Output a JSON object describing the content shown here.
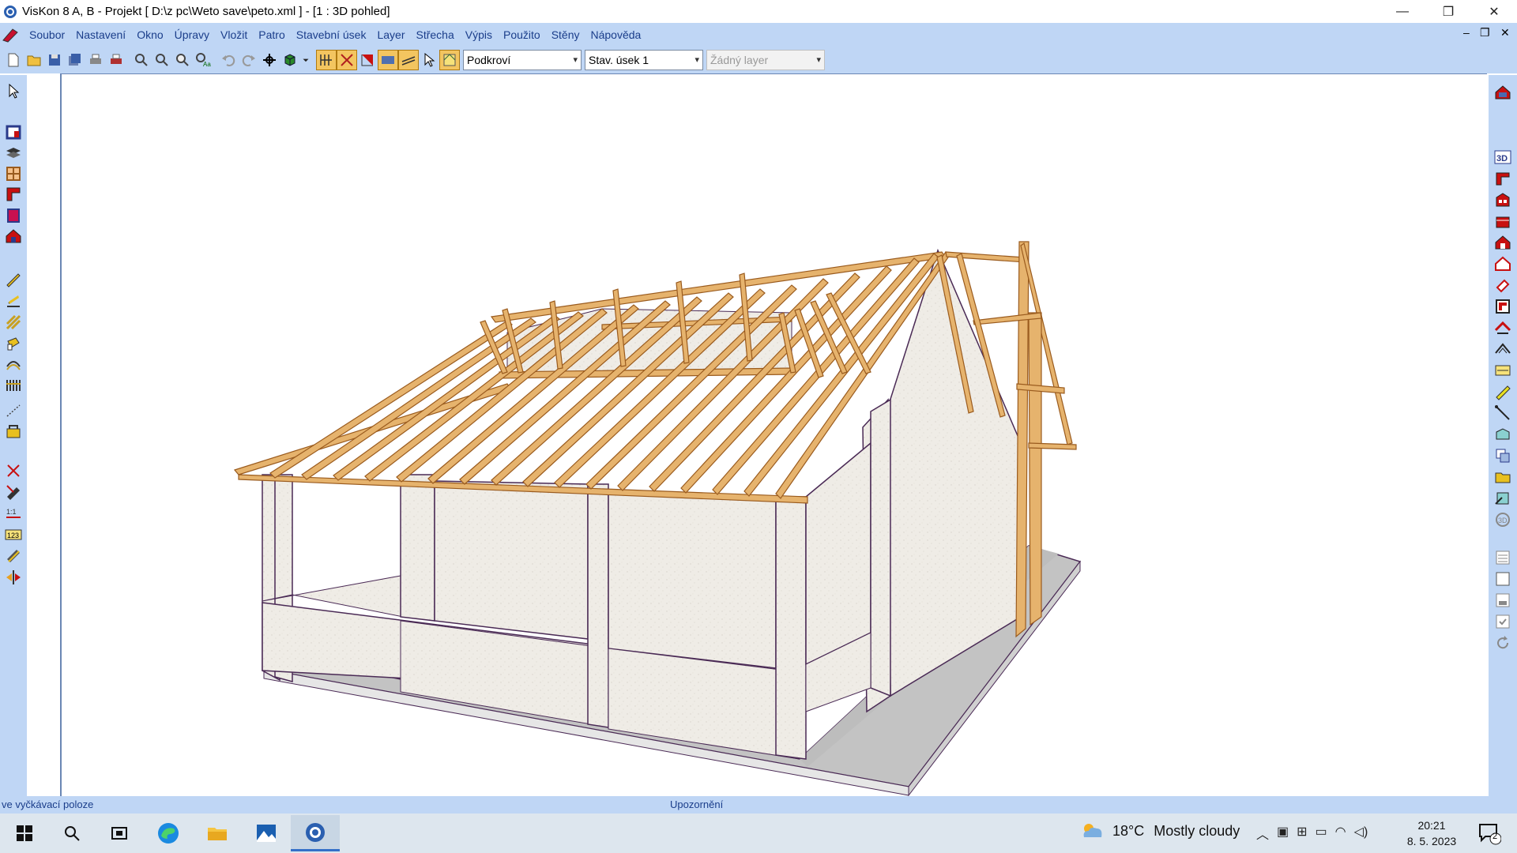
{
  "window": {
    "title": "VisKon 8 A, B - Projekt [ D:\\z pc\\Weto save\\peto.xml ]  - [1 : 3D pohled]",
    "minimize": "—",
    "restore": "❐",
    "close": "✕"
  },
  "menu": {
    "items": [
      "Soubor",
      "Nastavení",
      "Okno",
      "Úpravy",
      "Vložit",
      "Patro",
      "Stavební úsek",
      "Layer",
      "Střecha",
      "Výpis",
      "Použito",
      "Stěny",
      "Nápověda"
    ],
    "mdi_minimize": "–",
    "mdi_restore": "❐",
    "mdi_close": "✕"
  },
  "toolbar": {
    "floor_select": "Podkroví",
    "section_select": "Stav. úsek 1",
    "layer_select": "Žádný layer"
  },
  "status": {
    "left": "ve vyčkávací poloze",
    "center": "Upozornění"
  },
  "taskbar": {
    "weather_temp": "18°C",
    "weather_text": "Mostly cloudy",
    "time": "20:21",
    "date": "8. 5. 2023",
    "notifications": "2"
  },
  "colors": {
    "chrome": "#bfd6f5",
    "menu_text": "#1a3d8a",
    "timber": "#e6b36d",
    "timber_edge": "#9a5b1e",
    "wall": "#efece6",
    "wall_edge": "#4a2a55",
    "slab_top": "#c0c0c0"
  }
}
